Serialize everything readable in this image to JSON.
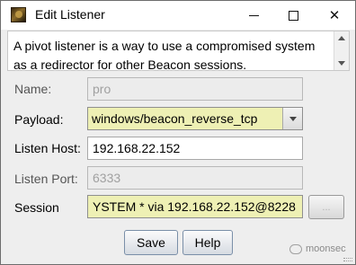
{
  "window": {
    "title": "Edit Listener",
    "icon": "beacon-app-icon"
  },
  "description": {
    "text": "A pivot listener is a way to use a compromised system as a redirector for other Beacon sessions."
  },
  "form": {
    "name": {
      "label": "Name:",
      "value": "pro",
      "enabled": false
    },
    "payload": {
      "label": "Payload:",
      "value": "windows/beacon_reverse_tcp"
    },
    "listen_host": {
      "label": "Listen Host:",
      "value": "192.168.22.152"
    },
    "listen_port": {
      "label": "Listen Port:",
      "value": "6333",
      "enabled": false
    },
    "session": {
      "label": "Session",
      "value": "YSTEM * via  192.168.22.152@8228",
      "browse_label": "..."
    }
  },
  "buttons": {
    "save": "Save",
    "help": "Help"
  },
  "watermark": {
    "text": "moonsec"
  },
  "colors": {
    "highlight_field": "#eef0b4",
    "window_bg": "#eeeeee"
  }
}
